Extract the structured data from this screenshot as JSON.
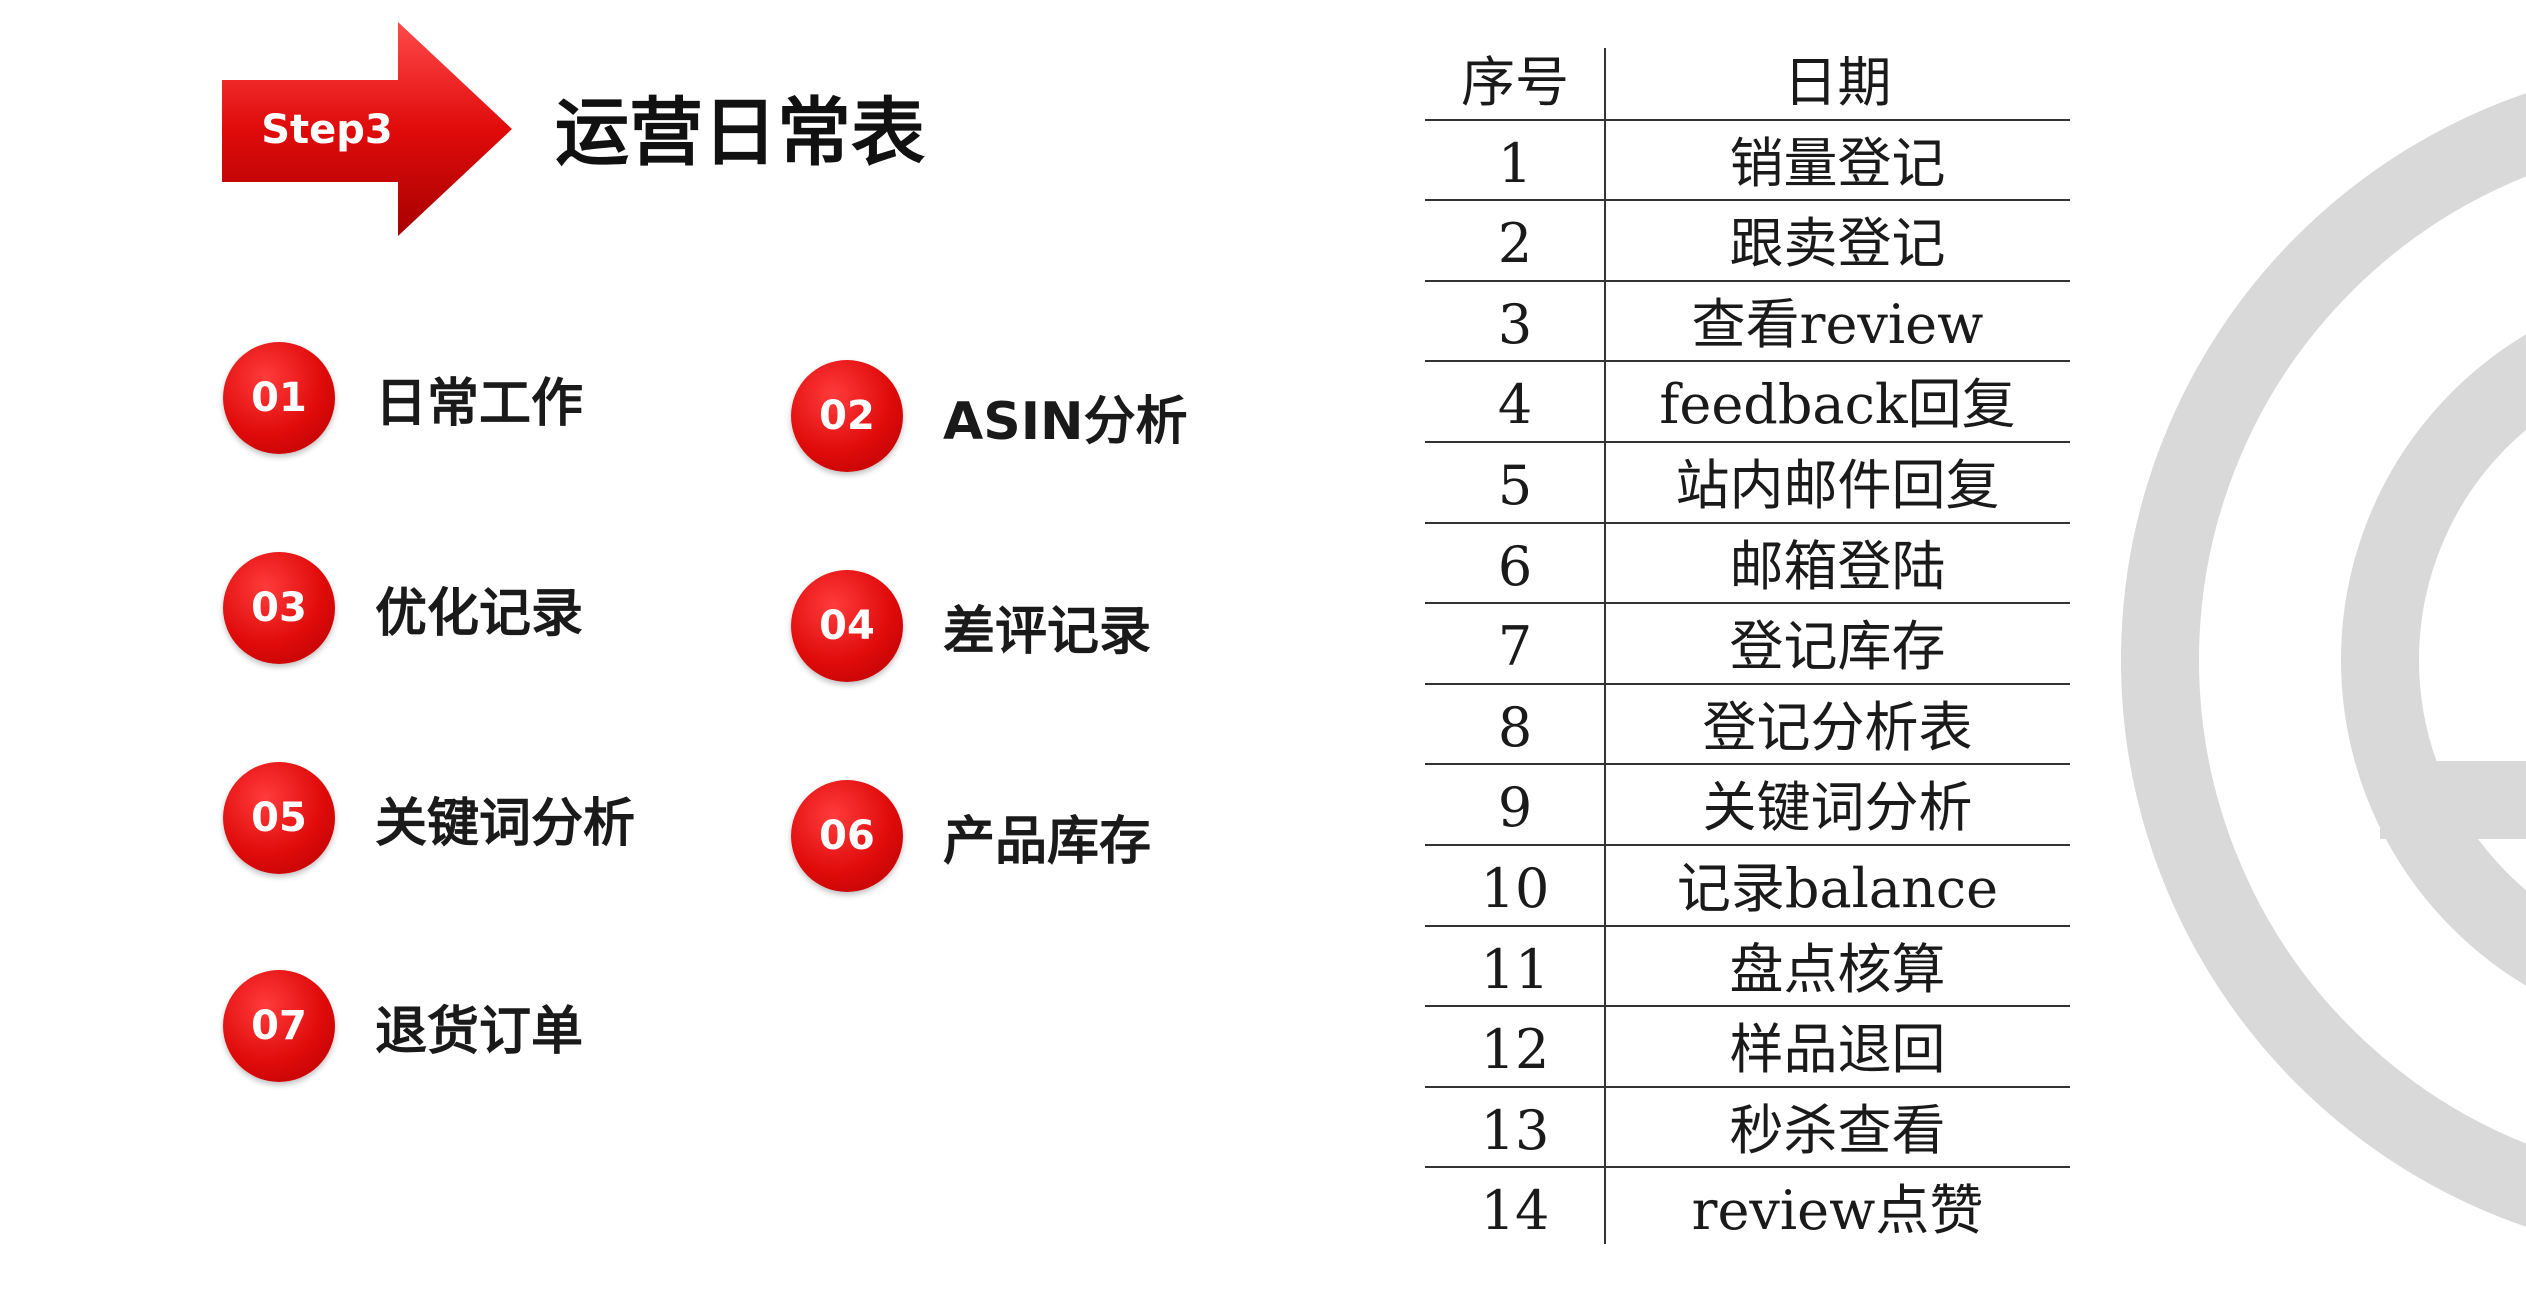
{
  "header": {
    "step_label": "Step3",
    "title": "运营日常表"
  },
  "items": [
    {
      "num": "01",
      "label": "日常工作"
    },
    {
      "num": "02",
      "label": "ASIN分析"
    },
    {
      "num": "03",
      "label": "优化记录"
    },
    {
      "num": "04",
      "label": "差评记录"
    },
    {
      "num": "05",
      "label": "关键词分析"
    },
    {
      "num": "06",
      "label": "产品库存"
    },
    {
      "num": "07",
      "label": "退货订单"
    }
  ],
  "table": {
    "headers": [
      "序号",
      "日期"
    ],
    "rows": [
      [
        "1",
        "销量登记"
      ],
      [
        "2",
        "跟卖登记"
      ],
      [
        "3",
        "查看review"
      ],
      [
        "4",
        "feedback回复"
      ],
      [
        "5",
        "站内邮件回复"
      ],
      [
        "6",
        "邮箱登陆"
      ],
      [
        "7",
        "登记库存"
      ],
      [
        "8",
        "登记分析表"
      ],
      [
        "9",
        "关键词分析"
      ],
      [
        "10",
        "记录balance"
      ],
      [
        "11",
        "盘点核算"
      ],
      [
        "12",
        "样品退回"
      ],
      [
        "13",
        "秒杀查看"
      ],
      [
        "14",
        "review点赞"
      ]
    ]
  },
  "colors": {
    "accent_red": "#e00b0b",
    "watermark_gray": "#d9d9d9"
  }
}
